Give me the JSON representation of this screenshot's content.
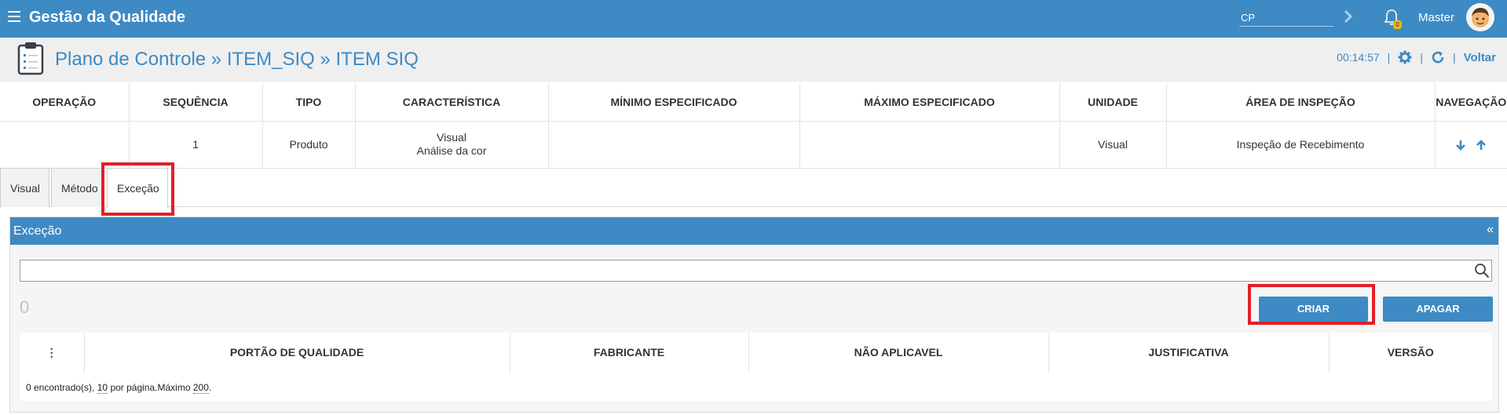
{
  "topbar": {
    "app_title": "Gestão da Qualidade",
    "cp_value": "CP",
    "bell_badge": "0",
    "username": "Master"
  },
  "header": {
    "title": "Plano de Controle » ITEM_SIQ » ITEM SIQ",
    "timer": "00:14:57",
    "sep": "|",
    "back_label": "Voltar"
  },
  "operation_table": {
    "columns": [
      "OPERAÇÃO",
      "SEQUÊNCIA",
      "TIPO",
      "CARACTERÍSTICA",
      "MÍNIMO ESPECIFICADO",
      "MÁXIMO ESPECIFICADO",
      "UNIDADE",
      "ÁREA DE INSPEÇÃO",
      "NAVEGAÇÃO"
    ],
    "row": {
      "operacao": "",
      "sequencia": "1",
      "tipo": "Produto",
      "caracteristica_line1": "Visual",
      "caracteristica_line2": "Análise da cor",
      "minimo": "",
      "maximo": "",
      "unidade": "Visual",
      "area": "Inspeção de Recebimento"
    }
  },
  "tabs": [
    "Visual",
    "Método",
    "Exceção"
  ],
  "active_tab": "Exceção",
  "panel": {
    "title": "Exceção",
    "collapse_glyph": "«",
    "search_value": "",
    "count": "0",
    "create_label": "CRIAR",
    "delete_label": "APAGAR",
    "columns": [
      "⋮",
      "PORTÃO DE QUALIDADE",
      "FABRICANTE",
      "NÃO APLICAVEL",
      "JUSTIFICATIVA",
      "VERSÃO"
    ],
    "footer": {
      "found": "0 encontrado(s),",
      "per_page_value": "10",
      "per_page_text": "por página.Máximo",
      "max_value": "200",
      "end": "."
    }
  },
  "colors": {
    "brand": "#3d8ac4",
    "highlight": "#e1202a",
    "header_bg": "#efefef"
  },
  "icons": [
    "menu-icon",
    "chevron-right-icon",
    "bell-icon",
    "avatar",
    "clipboard-icon",
    "gear-icon",
    "refresh-icon",
    "arrow-down-icon",
    "arrow-up-icon",
    "search-icon",
    "more-vertical-icon"
  ]
}
